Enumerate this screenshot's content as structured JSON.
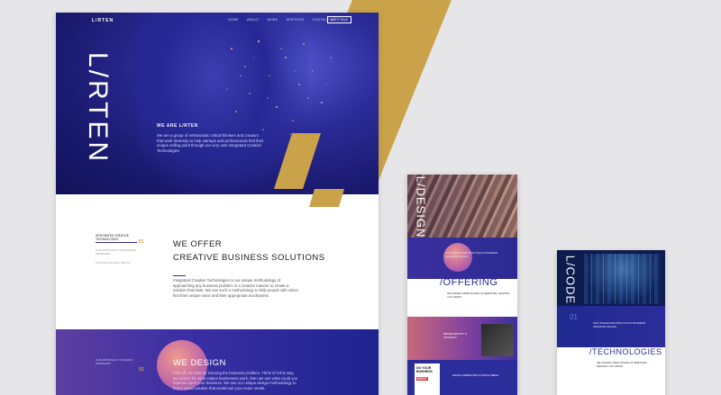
{
  "colors": {
    "accent_gold": "#c9a24a",
    "brand_indigo": "#2c2c9a",
    "background": "#e6e6e8"
  },
  "main": {
    "logo": "L/RTEN",
    "nav": [
      "HOME",
      "ABOUT",
      "WORK",
      "SERVICES",
      "CONTACT US"
    ],
    "nav_cta": "LET'S TALK",
    "vertical_logo": "L/RTEN",
    "hero_heading": "WE ARE L/RTEN",
    "hero_text": "We are a group of enthusiastic critical thinkers and creators that work tirelessly to help startups and professionals find their unique selling point through our very own Integrated Creative Technologies",
    "offer_side": {
      "item1": "INTEGRATED CREATIVE TECHNOLOGIES",
      "item2": "OUR APPROACH TO BUSINESS PROBLEMS",
      "item3": "HOW WE DO WHAT WE DO"
    },
    "offer_num": "01",
    "offer_title_line1": "WE OFFER",
    "offer_title_line2": "CREATIVE BUSINESS SOLUTIONS",
    "offer_text": "Integrated Creative Technologies is our unique methodology of approaching any business problem in a creative manner to create a solution that lasts. We use such a methodology to help people with vision find their unique voice and their appropriate touchpoints.",
    "design_side": "OUR APPROACH TO DESIGN PROBLEMS",
    "design_num": "02",
    "design_title": "WE DESIGN",
    "design_text": "First off, we start by learning the business problem. Think of it this way, we search for what makes businesses work, then we use what could you improve upon your business. We use our unique design methodology to find a visual solution that would suit your exact needs."
  },
  "mobile_a": {
    "vertical_logo": "L/DESIGN",
    "band_text": "OUR INTEGRATED PRACTICE IN BUSINESS ORIENTED DESIGN",
    "offering_title": "/OFFERING",
    "offer_text": "WE OFFER A WIDE RANGE OF SERVICES, HELPING YOU GROW",
    "card1_text": "BRAND IDENTITY & STRATEGY",
    "book_title": "DO YOUR BUSINESS",
    "book_title2": "RIGHT",
    "card2_text": "DIGITAL MARKETING & SOCIAL MEDIA"
  },
  "mobile_b": {
    "vertical_logo": "L/CODE",
    "band_num": "01",
    "band_text": "OUR INTEGRATED PRACTICE IN BUSINESS ORIENTED DESIGN",
    "tech_title": "/TECHNOLOGIES",
    "tech_text": "WE OFFER A WIDE RANGE OF SERVICES, HELPING YOU GROW"
  }
}
